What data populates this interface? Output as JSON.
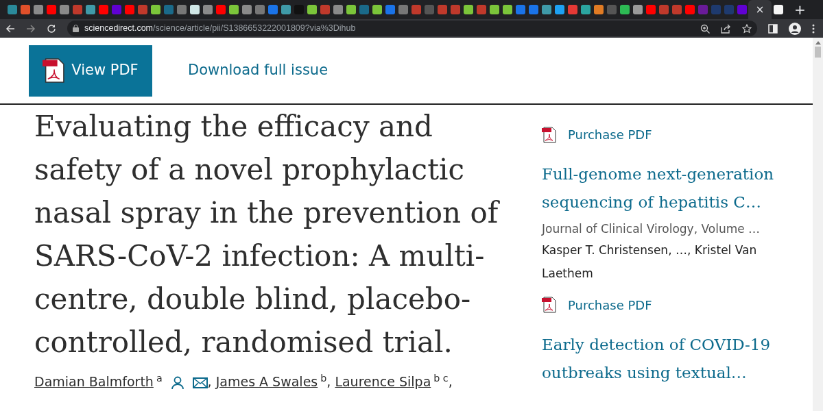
{
  "browser": {
    "tabs": [
      {
        "color": "#2a8a9a",
        "selected": false
      },
      {
        "color": "#e0502a",
        "selected": false
      },
      {
        "color": "#8a8a8a",
        "selected": false
      },
      {
        "color": "#ff0000",
        "selected": false
      },
      {
        "color": "#8a8a8a",
        "selected": false
      },
      {
        "color": "#c0392b",
        "selected": false
      },
      {
        "color": "#3f9aa8",
        "selected": false
      },
      {
        "color": "#ff0000",
        "selected": false
      },
      {
        "color": "#6001d2",
        "selected": false
      },
      {
        "color": "#ff0000",
        "selected": false
      },
      {
        "color": "#c0392b",
        "selected": false
      },
      {
        "color": "#7bc53a",
        "selected": false
      },
      {
        "color": "#1a6a8a",
        "selected": false
      },
      {
        "color": "#777777",
        "selected": false
      },
      {
        "color": "#cfe6e6",
        "selected": false
      },
      {
        "color": "#8a8a8a",
        "selected": false
      },
      {
        "color": "#ff0000",
        "selected": false
      },
      {
        "color": "#7bc53a",
        "selected": false
      },
      {
        "color": "#8a8a8a",
        "selected": false
      },
      {
        "color": "#777777",
        "selected": false
      },
      {
        "color": "#1a73e8",
        "selected": false
      },
      {
        "color": "#3f9aa8",
        "selected": false
      },
      {
        "color": "#111111",
        "selected": false
      },
      {
        "color": "#7bc53a",
        "selected": false
      },
      {
        "color": "#c0392b",
        "selected": false
      },
      {
        "color": "#8a8a8a",
        "selected": false
      },
      {
        "color": "#7bc53a",
        "selected": false
      },
      {
        "color": "#1a6a8a",
        "selected": false
      },
      {
        "color": "#7bc53a",
        "selected": false
      },
      {
        "color": "#1a73e8",
        "selected": false
      },
      {
        "color": "#777777",
        "selected": false
      },
      {
        "color": "#c0392b",
        "selected": false
      },
      {
        "color": "#555555",
        "selected": false
      },
      {
        "color": "#c0392b",
        "selected": false
      },
      {
        "color": "#c0392b",
        "selected": false
      },
      {
        "color": "#7bc53a",
        "selected": false
      },
      {
        "color": "#c0392b",
        "selected": false
      },
      {
        "color": "#7bc53a",
        "selected": false
      },
      {
        "color": "#7bc53a",
        "selected": false
      },
      {
        "color": "#1a73e8",
        "selected": false
      },
      {
        "color": "#1a73e8",
        "selected": false
      },
      {
        "color": "#3f9aa8",
        "selected": false
      },
      {
        "color": "#1da1f2",
        "selected": false
      },
      {
        "color": "#e53935",
        "selected": false
      },
      {
        "color": "#2ba5a0",
        "selected": false
      },
      {
        "color": "#e07b24",
        "selected": false
      },
      {
        "color": "#555555",
        "selected": false
      },
      {
        "color": "#2dbb54",
        "selected": false
      },
      {
        "color": "#9a9a9a",
        "selected": false
      },
      {
        "color": "#ff0000",
        "selected": false
      },
      {
        "color": "#c0392b",
        "selected": false
      },
      {
        "color": "#c0392b",
        "selected": false
      },
      {
        "color": "#ff0000",
        "selected": false
      },
      {
        "color": "#6a1b9a",
        "selected": false
      },
      {
        "color": "#1e3a6e",
        "selected": false
      },
      {
        "color": "#1e3a6e",
        "selected": false
      },
      {
        "color": "#6001d2",
        "selected": false
      },
      {
        "selected": true
      },
      {
        "color": "#f5f5f5",
        "selected": false
      }
    ],
    "tab_close": "×",
    "new_tab": "+",
    "url_host": "sciencedirect.com",
    "url_path": "/science/article/pii/S1386653222001809?via%3Dihub"
  },
  "header": {
    "view_pdf": "View PDF",
    "download": "Download full issue"
  },
  "article": {
    "title": "Evaluating the efficacy and safety of a novel prophylactic nasal spray in the prevention of SARS-CoV-2 infection: A multi-centre, double blind, placebo-controlled, randomised trial.",
    "authors": [
      {
        "name": "Damian Balmforth",
        "sup": "a",
        "icons": true,
        "sep": ","
      },
      {
        "name": "James A Swales",
        "sup": "b",
        "sep": ","
      },
      {
        "name": "Laurence Silpa",
        "sup": "b c",
        "sep": ","
      }
    ]
  },
  "related": [
    {
      "kind": "purchase",
      "text": "Purchase PDF"
    },
    {
      "kind": "title",
      "text": "Full-genome next-generation sequencing of hepatitis C…"
    },
    {
      "kind": "journal",
      "text": "Journal of Clinical Virology, Volume …"
    },
    {
      "kind": "authors",
      "text": "Kasper T. Christensen, …, Kristel Van Laethem"
    },
    {
      "kind": "purchase",
      "text": "Purchase PDF"
    },
    {
      "kind": "title",
      "text": "Early detection of COVID-19 outbreaks using textual…"
    }
  ]
}
